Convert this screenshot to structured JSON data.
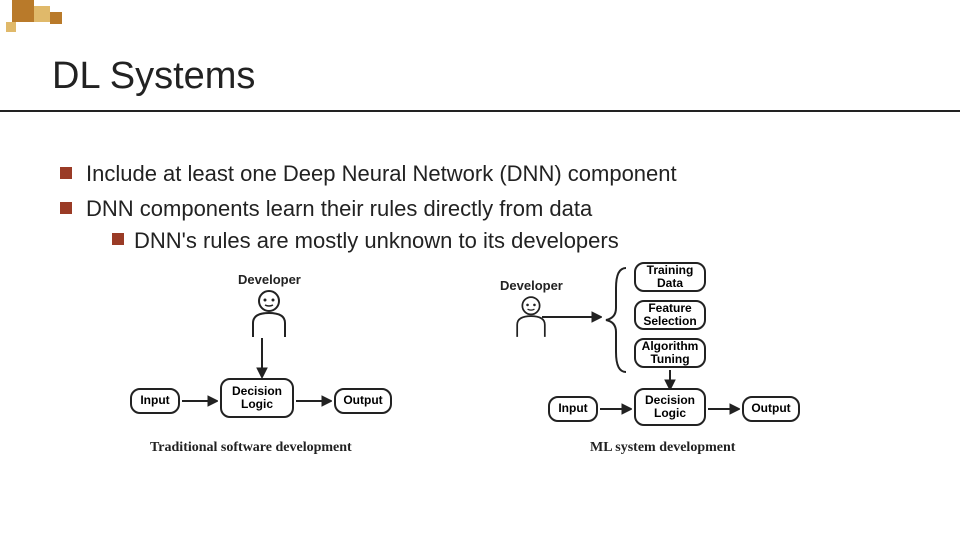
{
  "title": "DL Systems",
  "bullets": [
    "Include at least one Deep Neural Network (DNN) component",
    "DNN components learn their rules directly from data"
  ],
  "sub_bullet": "DNN's rules are mostly unknown to its developers",
  "diagram_left": {
    "developer": "Developer",
    "input": "Input",
    "decision": "Decision Logic",
    "output": "Output",
    "caption": "Traditional software development"
  },
  "diagram_right": {
    "developer": "Developer",
    "training": "Training Data",
    "feature": "Feature Selection",
    "algorithm": "Algorithm Tuning",
    "input": "Input",
    "decision": "Decision Logic",
    "output": "Output",
    "caption": "ML system development"
  }
}
